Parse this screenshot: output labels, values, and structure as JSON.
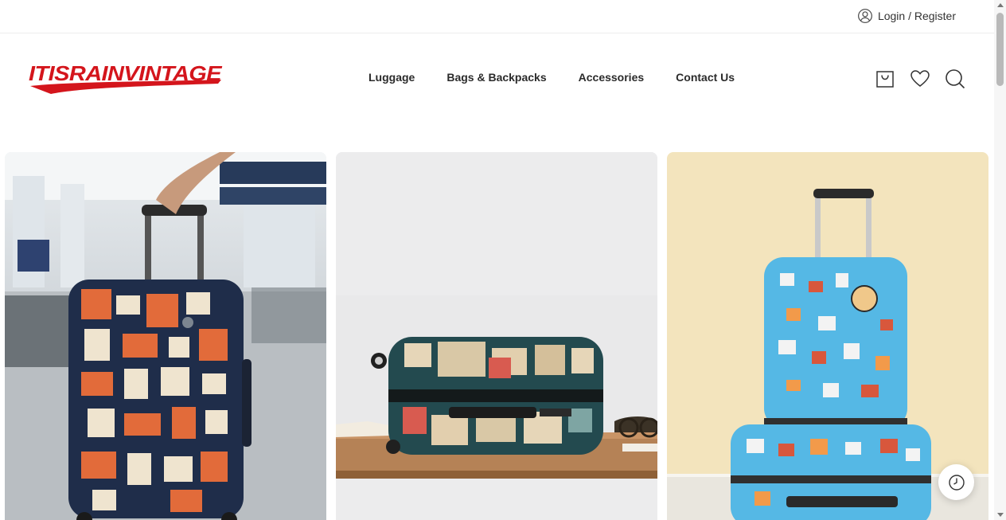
{
  "topbar": {
    "login_label": "Login / Register",
    "login_icon": "user-circle-icon"
  },
  "brand": {
    "logo_text": "ITISRAINVINTAGE",
    "color": "#d4151c"
  },
  "nav": {
    "items": [
      "Luggage",
      "Bags & Backpacks",
      "Accessories",
      "Contact Us"
    ]
  },
  "header_icons": [
    "bag-icon",
    "heart-icon",
    "search-icon"
  ],
  "products": [
    {
      "icon": "luggage-geometric-image"
    },
    {
      "icon": "luggage-vintage-stamps-image"
    },
    {
      "icon": "luggage-cartoon-print-image"
    }
  ],
  "floating": {
    "icon": "clock-history-icon"
  }
}
